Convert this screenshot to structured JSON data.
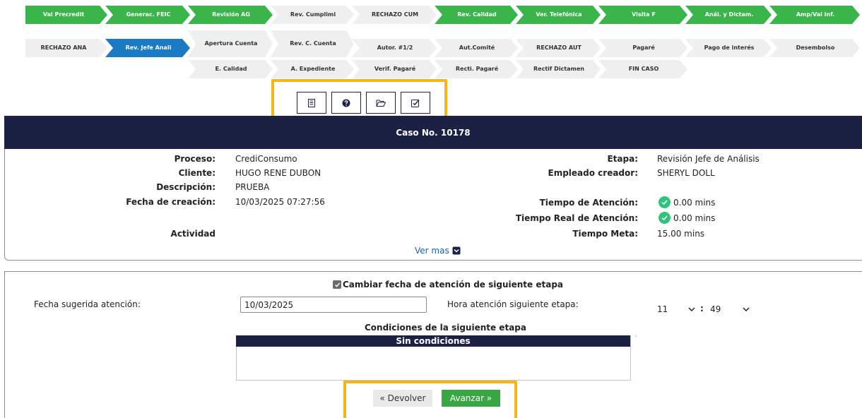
{
  "stages": {
    "row1": [
      {
        "label": "Val Precredit",
        "style": "green"
      },
      {
        "label": "Generac. FEIC",
        "style": "green"
      },
      {
        "label": "Revisión AG",
        "style": "green"
      },
      {
        "label": "Rev. Cumplimi",
        "style": "gray"
      },
      {
        "label": "RECHAZO CUM",
        "style": "gray"
      },
      {
        "label": "Rev. Calidad",
        "style": "green"
      },
      {
        "label": "Ver. Telefónica",
        "style": "green"
      },
      {
        "label": "Visita F",
        "style": "green"
      },
      {
        "label": "Anál. y Dictam.",
        "style": "green"
      },
      {
        "label": "Amp/Val inf.",
        "style": "green"
      }
    ],
    "row2": [
      {
        "label": "RECHAZO ANA",
        "style": "gray"
      },
      {
        "label": "Rev. Jefe Anali",
        "style": "blue"
      },
      {
        "label": "Apertura Cuenta",
        "style": "gray"
      },
      {
        "label": "Rev. C. Cuenta",
        "style": "gray"
      },
      {
        "label": "Autor. #1/2",
        "style": "gray"
      },
      {
        "label": "Aut.Comité",
        "style": "gray"
      },
      {
        "label": "RECHAZO AUT",
        "style": "gray"
      },
      {
        "label": "Pagaré",
        "style": "gray"
      },
      {
        "label": "Pago de interés",
        "style": "gray"
      },
      {
        "label": "Desembolso",
        "style": "gray"
      }
    ],
    "row3": [
      {
        "label": "E. Calidad",
        "style": "gray"
      },
      {
        "label": "A. Expediente",
        "style": "gray"
      },
      {
        "label": "Verif. Pagaré",
        "style": "gray"
      },
      {
        "label": "Recti. Pagaré",
        "style": "gray"
      },
      {
        "label": "Rectif Dictamen",
        "style": "gray"
      },
      {
        "label": "FIN CASO",
        "style": "gray"
      }
    ]
  },
  "toolbar": {
    "icons": [
      "document-icon",
      "help-icon",
      "folder-open-icon",
      "checklist-icon"
    ],
    "highlight_color": "#f6b515"
  },
  "case": {
    "title": "Caso No. 10178",
    "left": [
      {
        "label": "Proceso:",
        "value": "CrediConsumo"
      },
      {
        "label": "Cliente:",
        "value": "HUGO RENE DUBON"
      },
      {
        "label": "Descripción:",
        "value": "PRUEBA"
      },
      {
        "label": "Fecha de creación:",
        "value": "10/03/2025 07:27:56"
      },
      {
        "label": "Actividad",
        "value": ""
      }
    ],
    "right": [
      {
        "label": "Etapa:",
        "value": "Revisión Jefe de Análisis"
      },
      {
        "label": "Empleado creador:",
        "value": "SHERYL DOLL"
      },
      {
        "label": "Tiempo de Atención:",
        "value": "0.00 mins"
      },
      {
        "label": "Tiempo Real de Atención:",
        "value": "0.00 mins"
      },
      {
        "label": "Tiempo Meta:",
        "value": "15.00 mins"
      }
    ],
    "ver_mas": "Ver mas"
  },
  "form": {
    "change_date_label": "Cambiar fecha de atención de siguiente etapa",
    "change_date_checked": true,
    "suggested_date_label": "Fecha sugerida atención:",
    "suggested_date_value": "10/03/2025",
    "time_label": "Hora atención siguiente etapa:",
    "hour": "11",
    "minute": "49",
    "time_separator": ":",
    "conditions_title": "Condiciones de la siguiente etapa",
    "conditions_header": "Sin condiciones",
    "back_button": "« Devolver",
    "next_button": "Avanzar »"
  },
  "colors": {
    "header_navy": "#1c2144",
    "stage_green": "#39b54a",
    "stage_blue": "#1a7bc4",
    "stage_gray": "#efefef",
    "advance_green": "#3aa745",
    "highlight": "#f6b515"
  }
}
